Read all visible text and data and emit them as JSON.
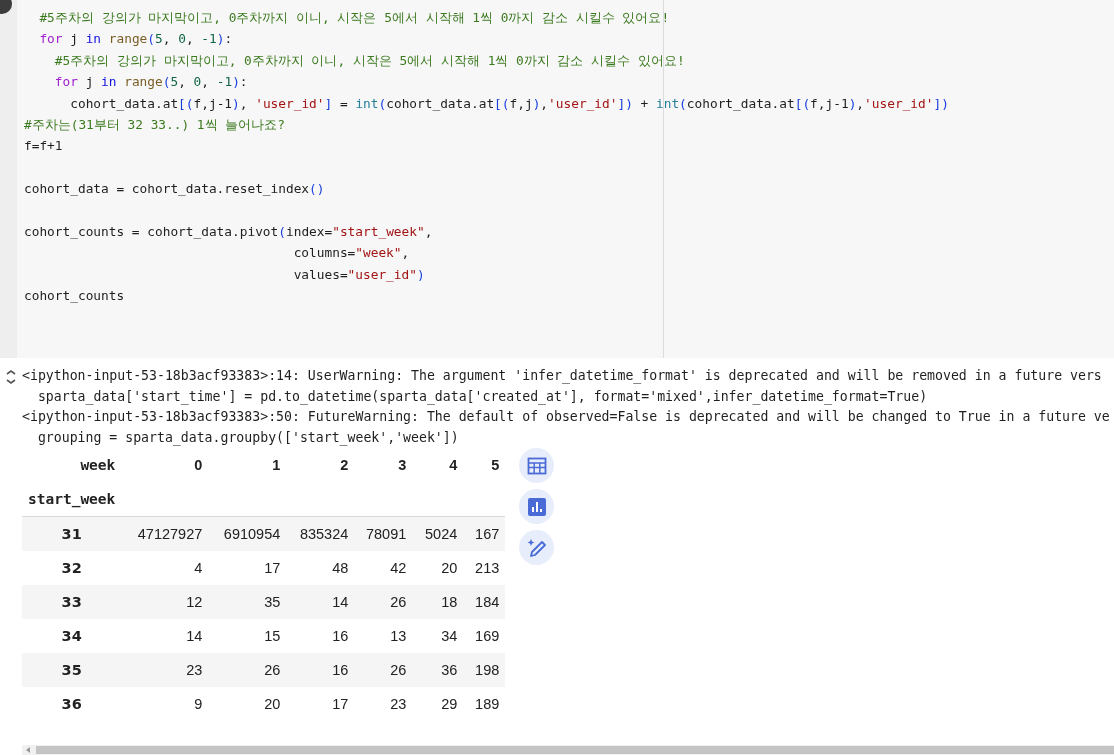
{
  "code_cell": {
    "lines": [
      {
        "kind": "code",
        "tokens": [
          {
            "kind": "comment",
            "text": "  #5주차의 강의가 마지막이고, 0주차까지 이니, 시작은 5에서 시작해 1씩 0까지 감소 시킬수 있어요!"
          }
        ]
      },
      {
        "kind": "code",
        "tokens": [
          {
            "kind": "keyword",
            "text": "  for"
          },
          {
            "kind": "plain",
            "text": " j "
          },
          {
            "kind": "operator",
            "text": "in"
          },
          {
            "kind": "function",
            "text": " range"
          },
          {
            "kind": "bracket",
            "text": "("
          },
          {
            "kind": "number",
            "text": "5"
          },
          {
            "kind": "plain",
            "text": ", "
          },
          {
            "kind": "number",
            "text": "0"
          },
          {
            "kind": "plain",
            "text": ", "
          },
          {
            "kind": "number",
            "text": "-1"
          },
          {
            "kind": "bracket",
            "text": ")"
          },
          {
            "kind": "plain",
            "text": ":"
          }
        ]
      },
      {
        "kind": "code",
        "tokens": [
          {
            "kind": "comment",
            "text": "    #5주차의 강의가 마지막이고, 0주차까지 이니, 시작은 5에서 시작해 1씩 0까지 감소 시킬수 있어요!"
          }
        ]
      },
      {
        "kind": "code",
        "tokens": [
          {
            "kind": "keyword",
            "text": "    for"
          },
          {
            "kind": "plain",
            "text": " j "
          },
          {
            "kind": "operator",
            "text": "in"
          },
          {
            "kind": "function",
            "text": " range"
          },
          {
            "kind": "bracket",
            "text": "("
          },
          {
            "kind": "number",
            "text": "5"
          },
          {
            "kind": "plain",
            "text": ", "
          },
          {
            "kind": "number",
            "text": "0"
          },
          {
            "kind": "plain",
            "text": ", "
          },
          {
            "kind": "number",
            "text": "-1"
          },
          {
            "kind": "bracket",
            "text": ")"
          },
          {
            "kind": "plain",
            "text": ":"
          }
        ]
      },
      {
        "kind": "code",
        "tokens": [
          {
            "kind": "plain",
            "text": "      cohort_data.at"
          },
          {
            "kind": "bracket",
            "text": "[("
          },
          {
            "kind": "plain",
            "text": "f,j-1"
          },
          {
            "kind": "bracket",
            "text": ")"
          },
          {
            "kind": "plain",
            "text": ", "
          },
          {
            "kind": "string",
            "text": "'user_id'"
          },
          {
            "kind": "bracket",
            "text": "]"
          },
          {
            "kind": "plain",
            "text": " = "
          },
          {
            "kind": "builtin",
            "text": "int"
          },
          {
            "kind": "bracket",
            "text": "("
          },
          {
            "kind": "plain",
            "text": "cohort_data.at"
          },
          {
            "kind": "bracket",
            "text": "[("
          },
          {
            "kind": "plain",
            "text": "f,j"
          },
          {
            "kind": "bracket",
            "text": ")"
          },
          {
            "kind": "plain",
            "text": ","
          },
          {
            "kind": "string",
            "text": "'user_id'"
          },
          {
            "kind": "bracket",
            "text": "])"
          },
          {
            "kind": "plain",
            "text": " + "
          },
          {
            "kind": "builtin",
            "text": "int"
          },
          {
            "kind": "bracket",
            "text": "("
          },
          {
            "kind": "plain",
            "text": "cohort_data.at"
          },
          {
            "kind": "bracket",
            "text": "[("
          },
          {
            "kind": "plain",
            "text": "f,j-1"
          },
          {
            "kind": "bracket",
            "text": ")"
          },
          {
            "kind": "plain",
            "text": ","
          },
          {
            "kind": "string",
            "text": "'user_id'"
          },
          {
            "kind": "bracket",
            "text": "])"
          }
        ]
      },
      {
        "kind": "code",
        "tokens": [
          {
            "kind": "comment",
            "text": "#주차는(31부터 32 33..) 1씩 늘어나죠?"
          }
        ]
      },
      {
        "kind": "code",
        "tokens": [
          {
            "kind": "plain",
            "text": "f=f+1"
          }
        ]
      },
      {
        "kind": "blank"
      },
      {
        "kind": "code",
        "tokens": [
          {
            "kind": "plain",
            "text": "cohort_data = cohort_data.reset_index"
          },
          {
            "kind": "bracket",
            "text": "()"
          }
        ]
      },
      {
        "kind": "blank"
      },
      {
        "kind": "code",
        "tokens": [
          {
            "kind": "plain",
            "text": "cohort_counts = cohort_data.pivot"
          },
          {
            "kind": "bracket",
            "text": "("
          },
          {
            "kind": "plain",
            "text": "index="
          },
          {
            "kind": "string",
            "text": "\"start_week\""
          },
          {
            "kind": "plain",
            "text": ","
          }
        ]
      },
      {
        "kind": "code",
        "tokens": [
          {
            "kind": "plain",
            "text": "                                   columns="
          },
          {
            "kind": "string",
            "text": "\"week\""
          },
          {
            "kind": "plain",
            "text": ","
          }
        ]
      },
      {
        "kind": "code",
        "tokens": [
          {
            "kind": "plain",
            "text": "                                   values="
          },
          {
            "kind": "string",
            "text": "\"user_id\""
          },
          {
            "kind": "bracket",
            "text": ")"
          }
        ]
      },
      {
        "kind": "code",
        "tokens": [
          {
            "kind": "plain",
            "text": "cohort_counts"
          }
        ]
      }
    ]
  },
  "output": {
    "stderr": [
      "<ipython-input-53-18b3acf93383>:14: UserWarning: The argument 'infer_datetime_format' is deprecated and will be removed in a future vers",
      "  sparta_data['start_time'] = pd.to_datetime(sparta_data['created_at'], format='mixed',infer_datetime_format=True)",
      "<ipython-input-53-18b3acf93383>:50: FutureWarning: The default of observed=False is deprecated and will be changed to True in a future ve",
      "  grouping = sparta_data.groupby(['start_week','week'])"
    ],
    "table": {
      "columns_name": "week",
      "columns": [
        "0",
        "1",
        "2",
        "3",
        "4",
        "5"
      ],
      "index_name": "start_week",
      "rows": [
        {
          "index": "31",
          "values": [
            "47127927",
            "6910954",
            "835324",
            "78091",
            "5024",
            "167"
          ]
        },
        {
          "index": "32",
          "values": [
            "4",
            "17",
            "48",
            "42",
            "20",
            "213"
          ]
        },
        {
          "index": "33",
          "values": [
            "12",
            "35",
            "14",
            "26",
            "18",
            "184"
          ]
        },
        {
          "index": "34",
          "values": [
            "14",
            "15",
            "16",
            "13",
            "34",
            "169"
          ]
        },
        {
          "index": "35",
          "values": [
            "23",
            "26",
            "16",
            "26",
            "36",
            "198"
          ]
        },
        {
          "index": "36",
          "values": [
            "9",
            "20",
            "17",
            "23",
            "29",
            "189"
          ]
        }
      ]
    }
  }
}
